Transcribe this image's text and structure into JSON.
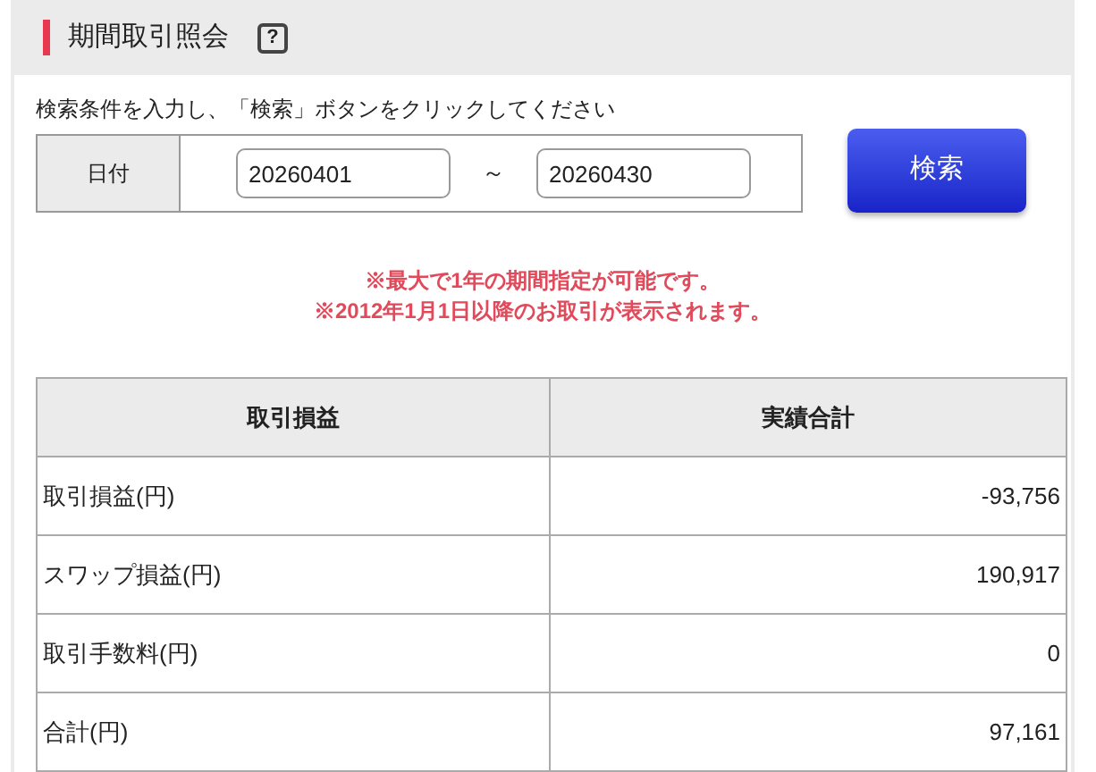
{
  "header": {
    "title": "期間取引照会",
    "help_icon": "?"
  },
  "instruction": "検索条件を入力し、「検索」ボタンをクリックしてください",
  "search_form": {
    "label": "日付",
    "from": "20260401",
    "separator": "～",
    "to": "20260430",
    "button": "検索"
  },
  "notes": [
    "※最大で1年の期間指定が可能です。",
    "※2012年1月1日以降のお取引が表示されます。"
  ],
  "table": {
    "columns": [
      "取引損益",
      "実績合計"
    ],
    "rows": [
      [
        "取引損益(円)",
        "-93,756"
      ],
      [
        "スワップ損益(円)",
        "190,917"
      ],
      [
        "取引手数料(円)",
        "0"
      ],
      [
        "合計(円)",
        "97,161"
      ]
    ]
  }
}
